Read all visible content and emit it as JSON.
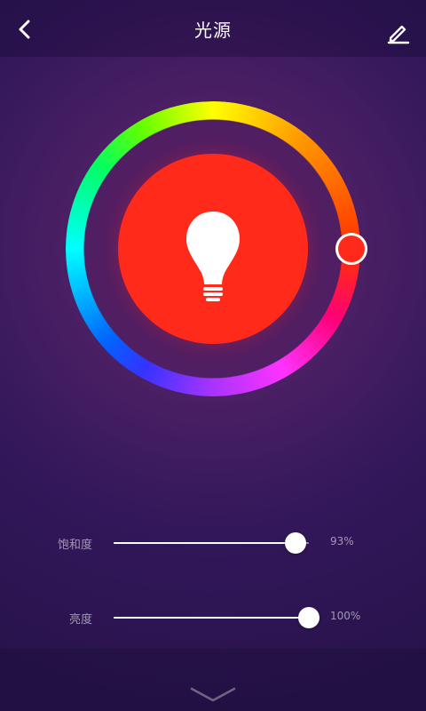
{
  "header": {
    "title": "光源",
    "back_icon": "chevron-left-icon",
    "edit_icon": "pencil-icon"
  },
  "color_picker": {
    "selected_color": "#ff2a1a",
    "center_icon": "light-bulb-icon"
  },
  "sliders": [
    {
      "id": "saturation",
      "label": "饱和度",
      "value_text": "93%",
      "value": 0.93
    },
    {
      "id": "brightness",
      "label": "亮度",
      "value_text": "100%",
      "value": 1.0
    }
  ],
  "bottom": {
    "icon": "chevron-down-icon"
  }
}
